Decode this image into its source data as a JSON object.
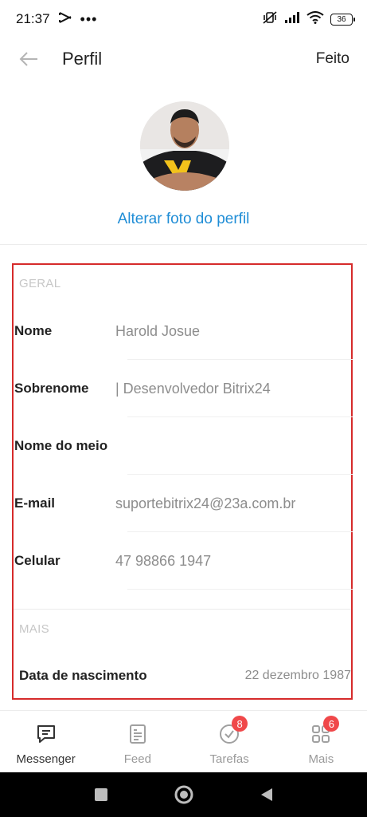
{
  "status_bar": {
    "time": "21:37",
    "battery": "36"
  },
  "header": {
    "title": "Perfil",
    "done_label": "Feito"
  },
  "profile": {
    "change_photo_label": "Alterar foto do perfil"
  },
  "sections": {
    "general_label": "GERAL",
    "more_label": "MAIS"
  },
  "fields": [
    {
      "label": "Nome",
      "value": "Harold Josue"
    },
    {
      "label": "Sobrenome",
      "value": "| Desenvolvedor Bitrix24"
    },
    {
      "label": "Nome do meio",
      "value": ""
    },
    {
      "label": "E-mail",
      "value": "suportebitrix24@23a.com.br"
    },
    {
      "label": "Celular",
      "value": "47 98866 1947"
    }
  ],
  "birthday": {
    "label": "Data de nascimento",
    "value": "22 dezembro 1987"
  },
  "tabs": [
    {
      "label": "Messenger",
      "icon": "chat-icon",
      "active": true
    },
    {
      "label": "Feed",
      "icon": "feed-icon"
    },
    {
      "label": "Tarefas",
      "icon": "check-circle-icon",
      "badge": "8"
    },
    {
      "label": "Mais",
      "icon": "grid-icon",
      "badge": "6"
    }
  ],
  "colors": {
    "accent": "#1f8dd6",
    "highlight_frame": "#d62b2b",
    "badge": "#f0484a"
  }
}
